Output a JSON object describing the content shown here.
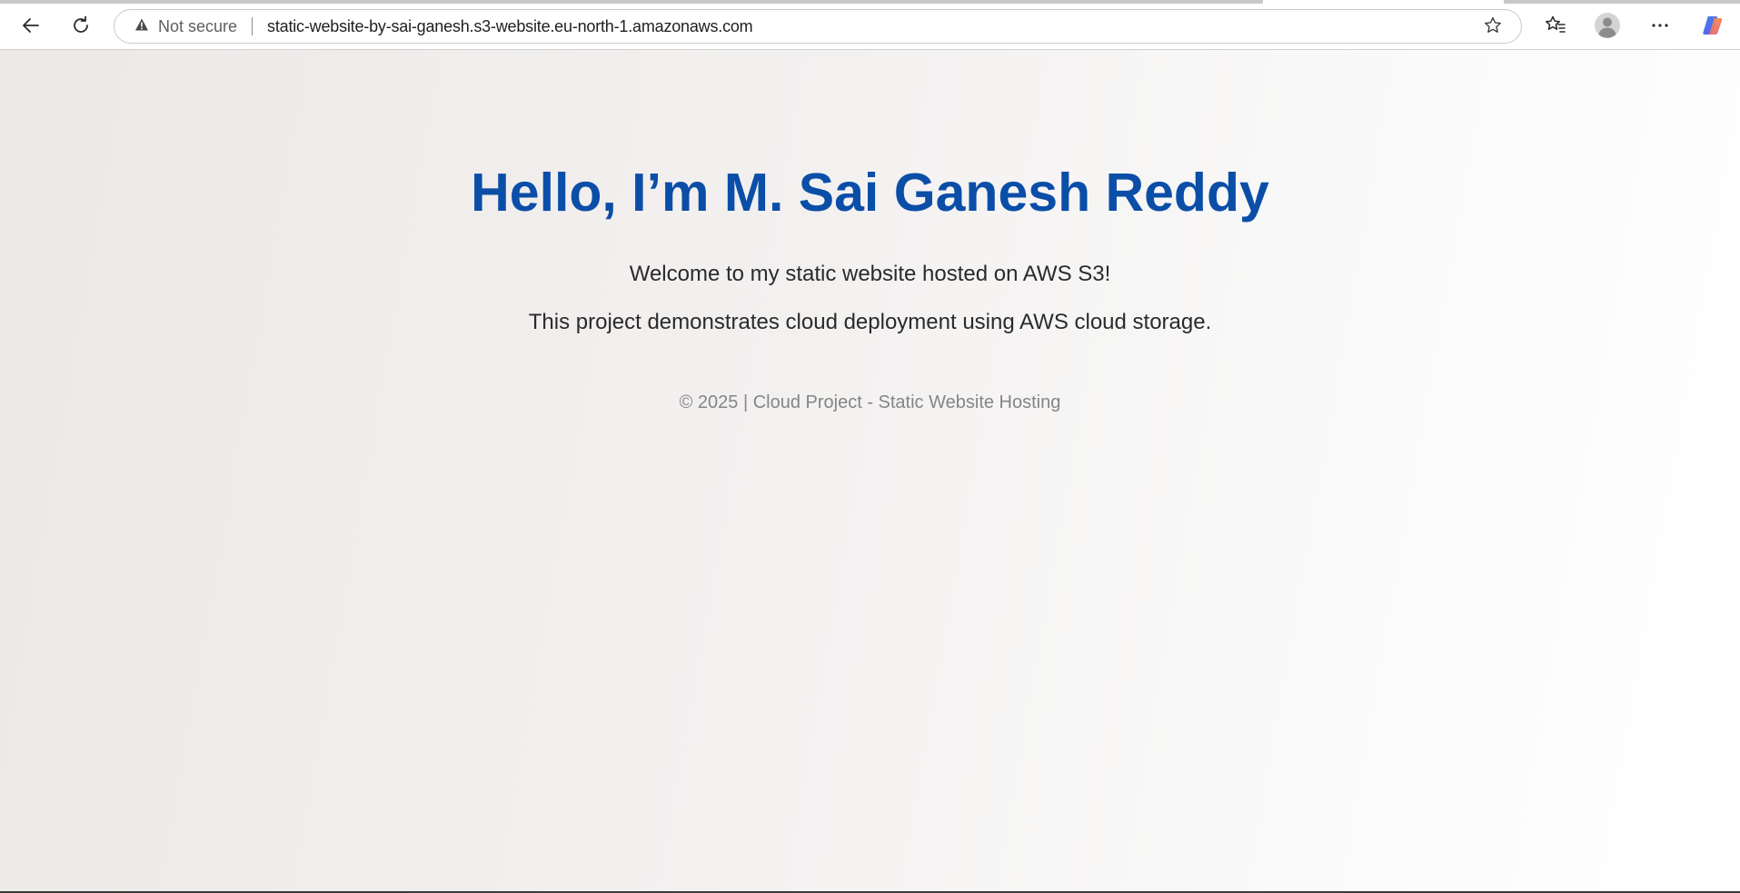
{
  "browser": {
    "security_label": "Not secure",
    "url": "static-website-by-sai-ganesh.s3-website.eu-north-1.amazonaws.com",
    "icons": {
      "back": "back-arrow-icon",
      "refresh": "refresh-icon",
      "warning": "warning-triangle-icon",
      "favorite": "star-icon",
      "favorites_list": "favorites-icon",
      "profile": "profile-avatar-icon",
      "menu": "more-dots-icon",
      "copilot": "copilot-icon"
    }
  },
  "page": {
    "headline": "Hello, I’m M. Sai Ganesh Reddy",
    "paragraphs": [
      "Welcome to my static website hosted on AWS S3!",
      "This project demonstrates cloud deployment using AWS cloud storage."
    ],
    "footer": "© 2025 | Cloud Project - Static Website Hosting"
  },
  "colors": {
    "headline": "#0b4ea8",
    "body_text": "#2a2a2a",
    "footer_text": "#858585"
  }
}
